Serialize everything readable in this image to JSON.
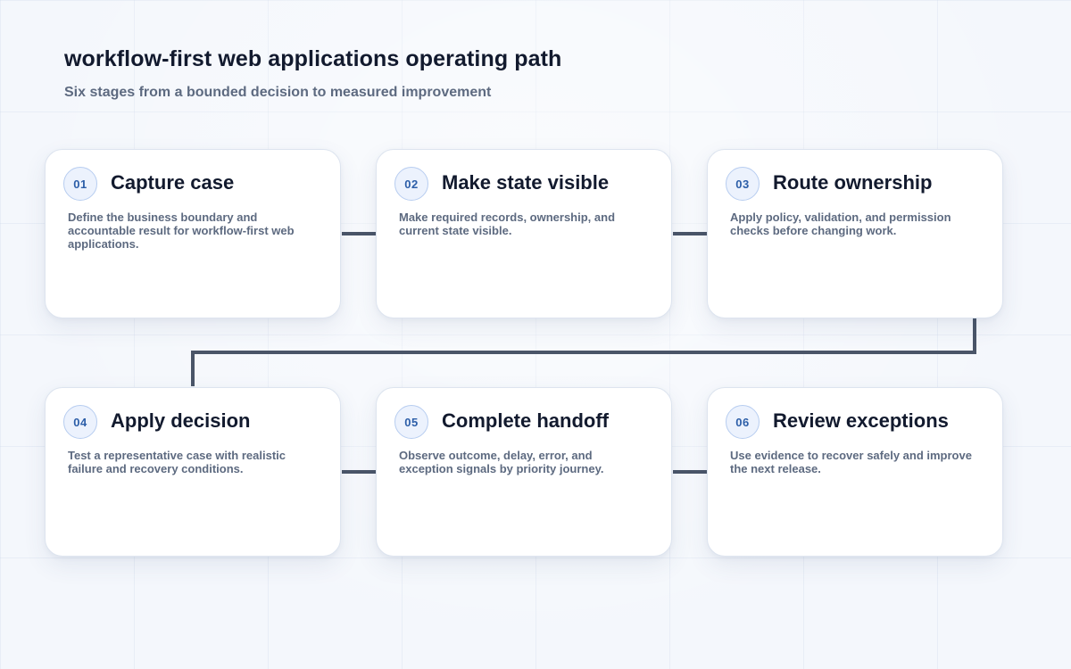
{
  "header": {
    "title": "workflow-first web applications operating path",
    "subtitle": "Six stages from a bounded decision to measured improvement"
  },
  "stages": [
    {
      "number": "01",
      "title": "Capture case",
      "description": "Define the business boundary and accountable result for workflow-first web applications."
    },
    {
      "number": "02",
      "title": "Make state visible",
      "description": "Make required records, ownership, and current state visible."
    },
    {
      "number": "03",
      "title": "Route ownership",
      "description": "Apply policy, validation, and permission checks before changing work."
    },
    {
      "number": "04",
      "title": "Apply decision",
      "description": "Test a representative case with realistic failure and recovery conditions."
    },
    {
      "number": "05",
      "title": "Complete handoff",
      "description": "Observe outcome, delay, error, and exception signals by priority journey."
    },
    {
      "number": "06",
      "title": "Review exceptions",
      "description": "Use evidence to recover safely and improve the next release."
    }
  ],
  "colors": {
    "connector": "#4a5568",
    "badge_text": "#2c5ea8",
    "badge_border": "#b7cdf0",
    "title_text": "#121a2e",
    "body_text": "#5d6a80"
  }
}
